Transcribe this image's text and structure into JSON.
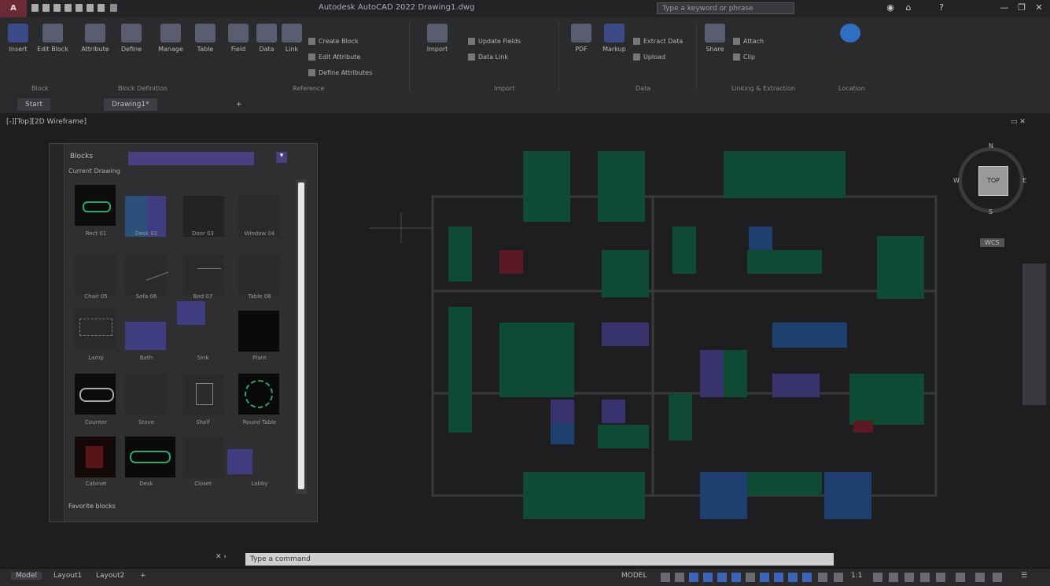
{
  "app": {
    "logo_letter": "A",
    "title": "Autodesk AutoCAD 2022  Drawing1.dwg"
  },
  "search": {
    "placeholder": "Type a keyword or phrase"
  },
  "window_controls": {
    "minimize": "—",
    "restore": "❐",
    "close": "✕"
  },
  "ribbon": {
    "buttons": [
      {
        "label": "Insert"
      },
      {
        "label": "Edit Block"
      },
      {
        "label": "Attribute"
      },
      {
        "label": "Define"
      },
      {
        "label": "Manage"
      },
      {
        "label": "Table"
      },
      {
        "label": "Field"
      },
      {
        "label": "Data"
      },
      {
        "label": "Link"
      },
      {
        "label": "Import"
      },
      {
        "label": "PDF"
      },
      {
        "label": "Markup"
      },
      {
        "label": "Share"
      }
    ],
    "small": [
      "Create Block",
      "Edit Attribute",
      "Define Attributes",
      "Update Fields",
      "Data Link",
      "Extract Data",
      "Upload",
      "Attach",
      "Clip"
    ],
    "panels": [
      "Block",
      "Block Definition",
      "Reference",
      "Import",
      "Data",
      "Linking & Extraction",
      "Location"
    ]
  },
  "tabs": [
    {
      "label": "Start"
    },
    {
      "label": "Drawing1*"
    },
    {
      "label": "+"
    }
  ],
  "view_label": "[-][Top][2D Wireframe]",
  "palette": {
    "search_label": "Blocks",
    "header": "Current Drawing",
    "items": [
      "Rect 01",
      "Desk 02",
      "Door 03",
      "Window 04",
      "Chair 05",
      "Sofa 06",
      "Bed 07",
      "Table 08",
      "Lamp",
      "Bath",
      "Sink",
      "Plant",
      "Counter",
      "Stove",
      "Shelf",
      "Round Table",
      "Cabinet",
      "Desk",
      "Closet",
      "Lobby"
    ],
    "footer": "Favorite blocks"
  },
  "viewcube": {
    "face": "TOP",
    "n": "N",
    "s": "S",
    "e": "E",
    "w": "W",
    "wcs": "WCS"
  },
  "command": {
    "prompt": "Type a command"
  },
  "status": {
    "tabs": [
      "Model",
      "Layout1",
      "Layout2",
      "+"
    ],
    "model": "MODEL",
    "scale": "1:1"
  }
}
